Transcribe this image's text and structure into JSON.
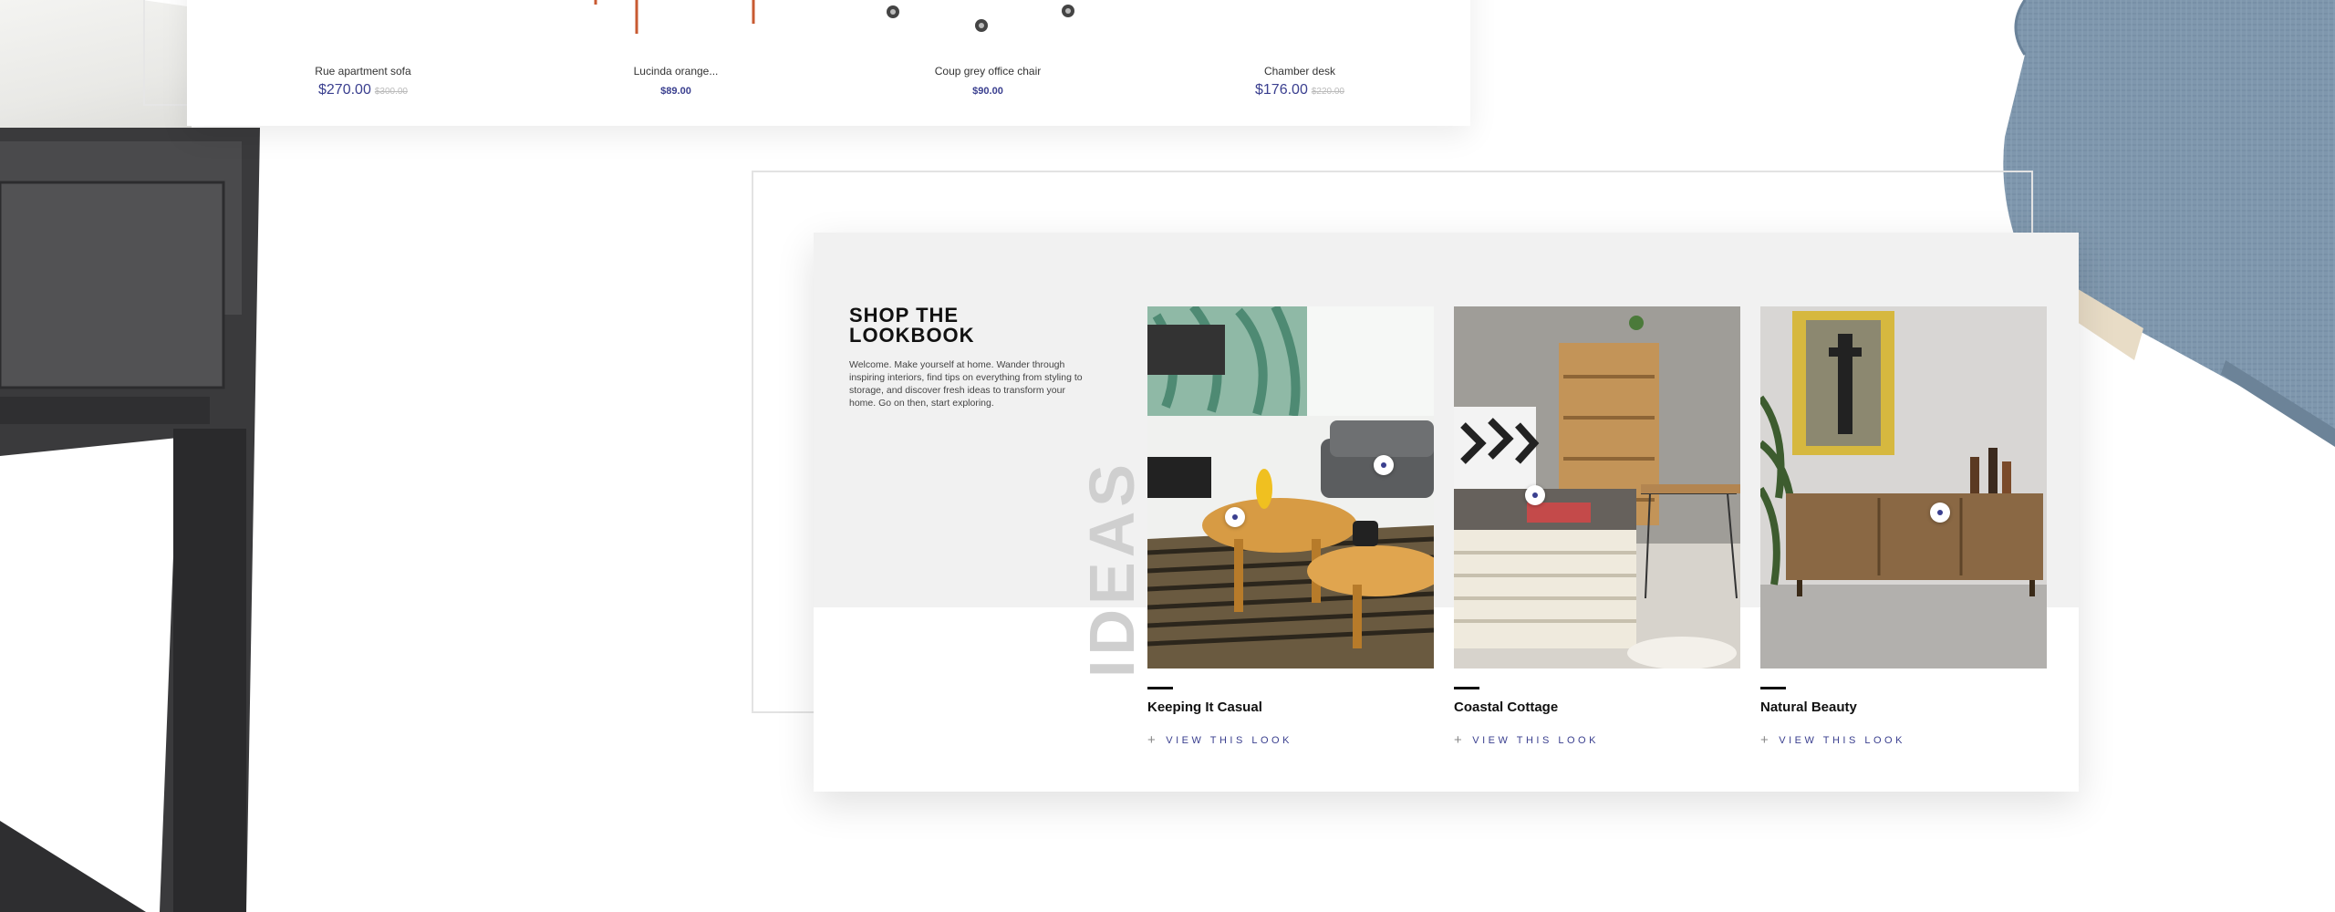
{
  "products": [
    {
      "name": "Rue apartment sofa",
      "price": "$270.00",
      "old_price": "$300.00"
    },
    {
      "name": "Lucinda orange...",
      "price": "$89.00",
      "old_price": ""
    },
    {
      "name": "Coup grey office chair",
      "price": "$90.00",
      "old_price": ""
    },
    {
      "name": "Chamber desk",
      "price": "$176.00",
      "old_price": "$220.00"
    }
  ],
  "lookbook": {
    "title_line1": "SHOP THE",
    "title_line2": "LOOKBOOK",
    "description": "Welcome. Make yourself at home. Wander through inspiring interiors, find tips on everything from styling to storage, and discover fresh ideas to transform your home. Go on then, start exploring.",
    "vertical_word": "IDEAS",
    "looks": [
      {
        "title": "Keeping It Casual",
        "link": "VIEW THIS LOOK",
        "image_icon": "living-room-photo"
      },
      {
        "title": "Coastal Cottage",
        "link": "VIEW THIS LOOK",
        "image_icon": "crate-shelf-photo"
      },
      {
        "title": "Natural Beauty",
        "link": "VIEW THIS LOOK",
        "image_icon": "sideboard-photo"
      }
    ]
  },
  "colors": {
    "accent": "#3a3f8f",
    "panel_gray": "#f1f1f1",
    "ideas_gray": "#cfcfcf"
  }
}
